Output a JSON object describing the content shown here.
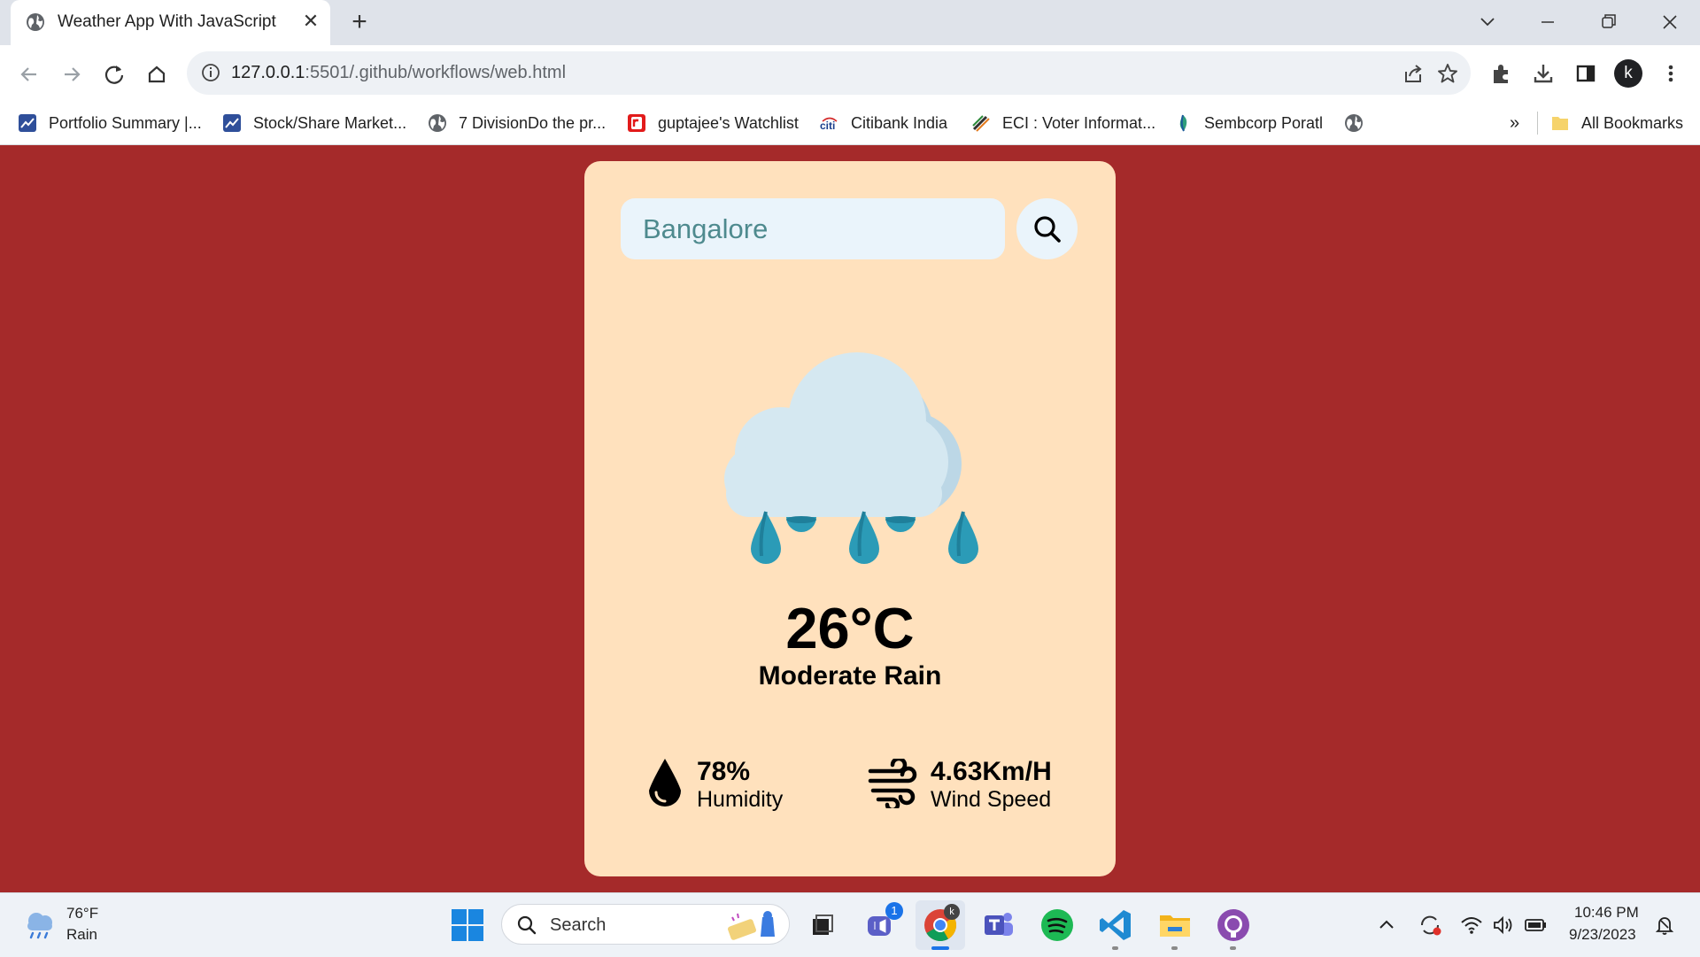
{
  "browser": {
    "tab_title": "Weather App With JavaScript",
    "tab_close": "✕",
    "new_tab": "+",
    "url_host": "127.0.0.1",
    "url_path": ":5501/.github/workflows/web.html",
    "profile_initial": "k",
    "bookmarks": [
      {
        "label": "Portfolio Summary |...",
        "icon": "chart-icon"
      },
      {
        "label": "Stock/Share Market...",
        "icon": "chart-icon"
      },
      {
        "label": "7 DivisionDo the pr...",
        "icon": "globe-icon"
      },
      {
        "label": "guptajee's Watchlist",
        "icon": "r-logo-icon"
      },
      {
        "label": "Citibank India",
        "icon": "citi-icon"
      },
      {
        "label": "ECI : Voter Informat...",
        "icon": "eci-icon"
      },
      {
        "label": "Sembcorp Poratl",
        "icon": "sembcorp-icon"
      }
    ],
    "bookmarks_overflow": "»",
    "all_bookmarks": "All Bookmarks"
  },
  "weather_app": {
    "search_value": "Bangalore",
    "icon": "rain-cloud-icon",
    "temperature": "26°C",
    "condition": "Moderate Rain",
    "humidity_value": "78%",
    "humidity_label": "Humidity",
    "wind_value": "4.63Km/H",
    "wind_label": "Wind Speed",
    "colors": {
      "background": "#a52a2a",
      "card": "#ffe1bd",
      "input": "#eaf4fb"
    }
  },
  "taskbar": {
    "weather_temp": "76°F",
    "weather_cond": "Rain",
    "search_label": "Search",
    "chat_badge": "1",
    "time": "10:46 PM",
    "date": "9/23/2023"
  }
}
